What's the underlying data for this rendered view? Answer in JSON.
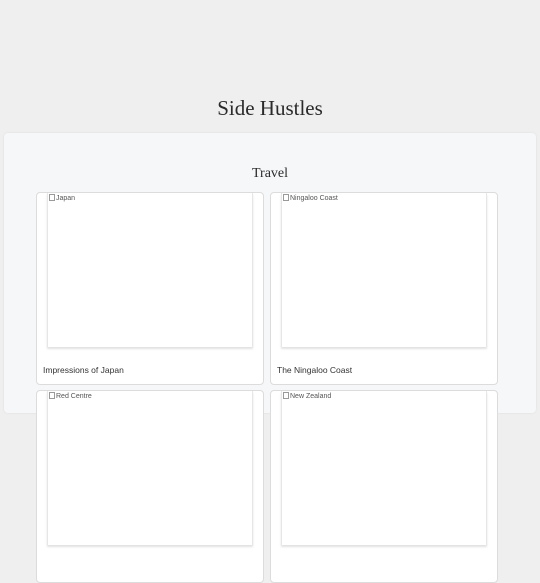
{
  "page": {
    "title": "Side Hustles"
  },
  "section": {
    "title": "Travel"
  },
  "cards": [
    {
      "image_alt": "Japan",
      "title": "Impressions of Japan"
    },
    {
      "image_alt": "Ningaloo Coast",
      "title": "The Ningaloo Coast"
    },
    {
      "image_alt": "Red Centre",
      "title": ""
    },
    {
      "image_alt": "New Zealand",
      "title": ""
    }
  ]
}
